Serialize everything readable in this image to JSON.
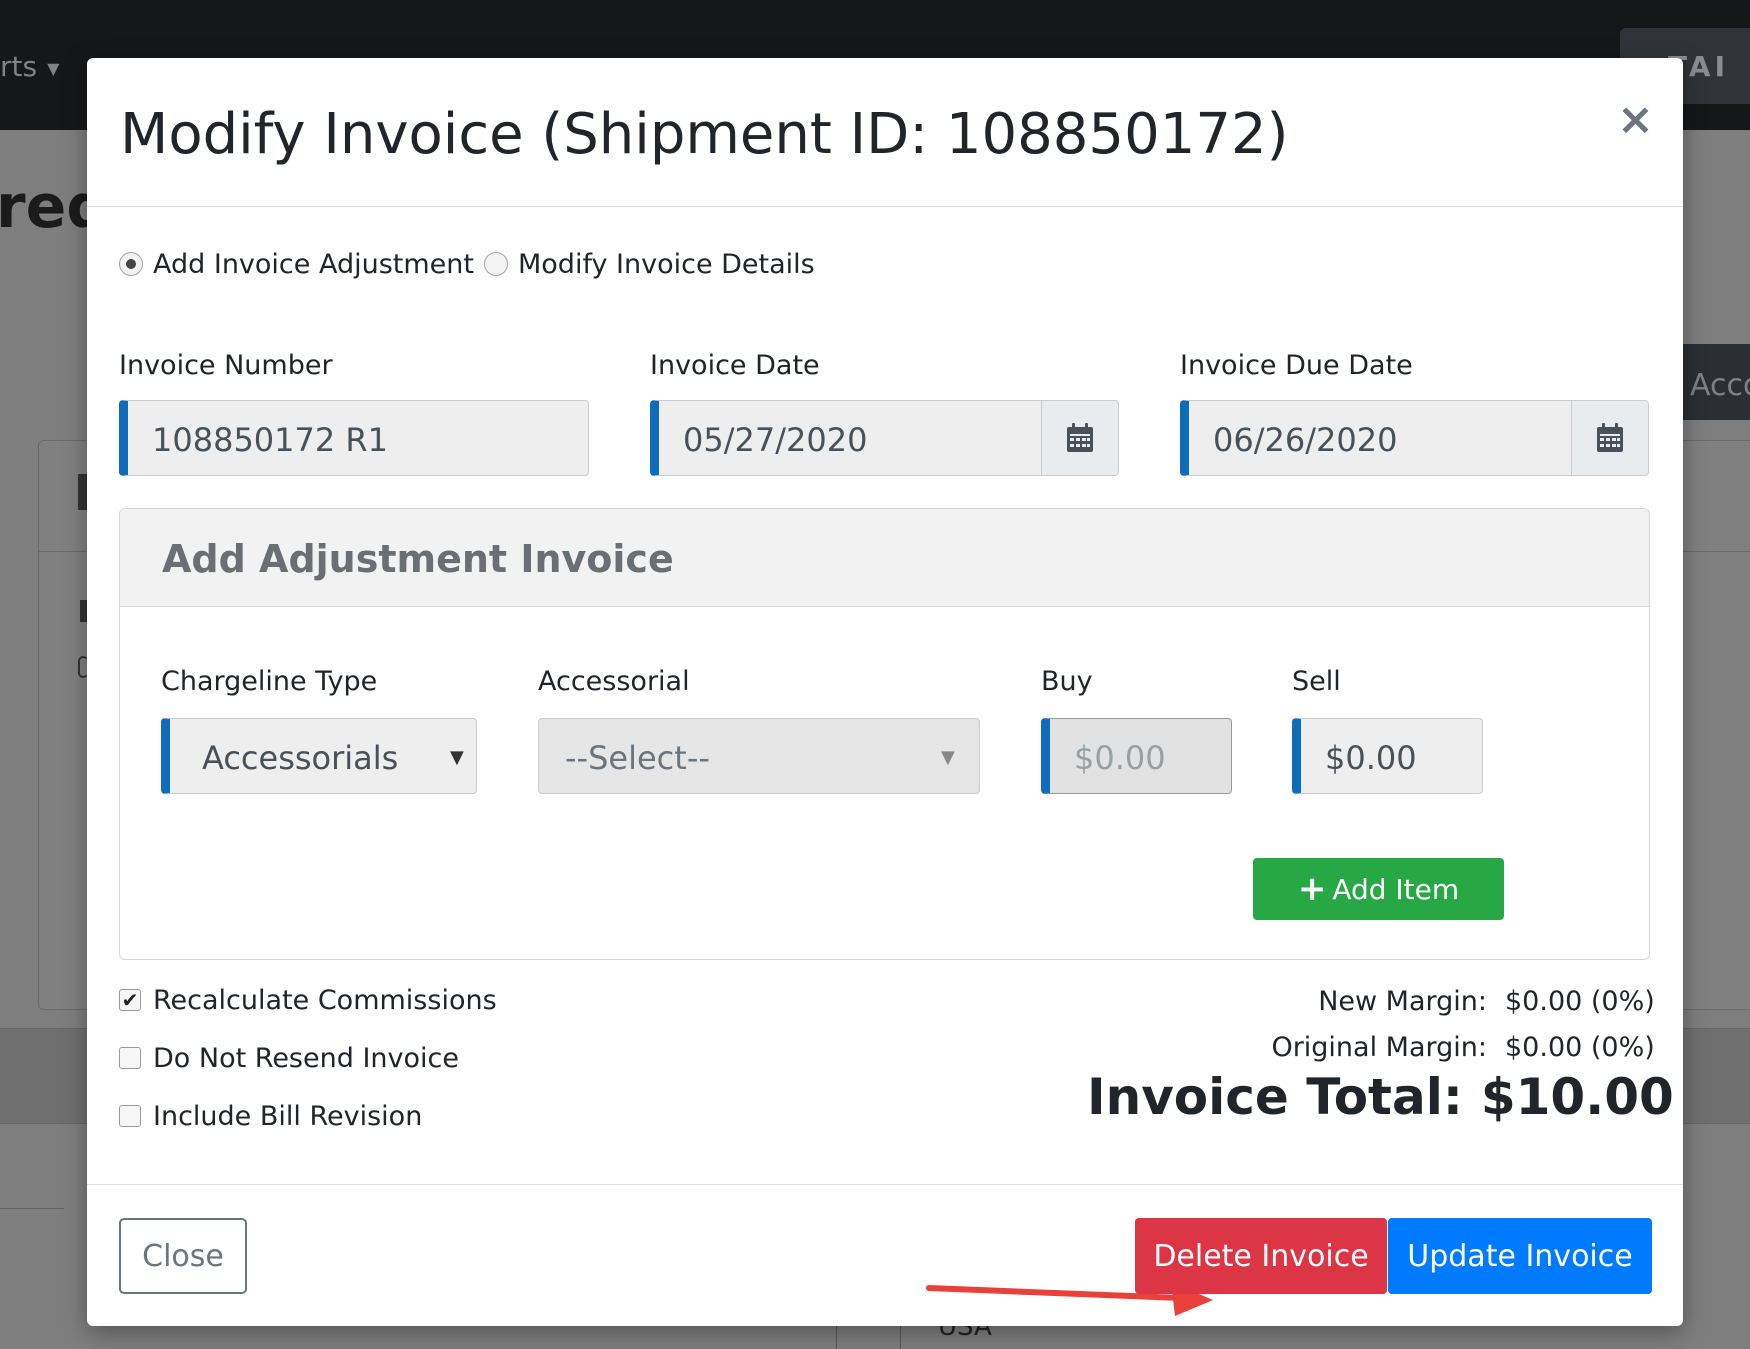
{
  "background": {
    "nav_text": "rts",
    "top_button_label": "TAI",
    "page_heading_fragment": "red",
    "right_button_fragment": "Acco",
    "country_text": "USA"
  },
  "modal": {
    "title": "Modify Invoice (Shipment ID: 108850172)",
    "close_symbol": "×",
    "mode_options": [
      {
        "label": "Add Invoice Adjustment",
        "selected": true
      },
      {
        "label": "Modify Invoice Details",
        "selected": false
      }
    ],
    "invoice_number": {
      "label": "Invoice Number",
      "value": "108850172 R1"
    },
    "invoice_date": {
      "label": "Invoice Date",
      "value": "05/27/2020"
    },
    "invoice_due_date": {
      "label": "Invoice Due Date",
      "value": "06/26/2020"
    },
    "adjustment": {
      "title": "Add Adjustment Invoice",
      "chargeline_type": {
        "label": "Chargeline Type",
        "value": "Accessorials"
      },
      "accessorial": {
        "label": "Accessorial",
        "value": "--Select--"
      },
      "buy": {
        "label": "Buy",
        "value": "$0.00"
      },
      "sell": {
        "label": "Sell",
        "value": "$0.00"
      },
      "add_item_label": "Add Item"
    },
    "options": [
      {
        "label": "Recalculate Commissions",
        "checked": true
      },
      {
        "label": "Do Not Resend Invoice",
        "checked": false
      },
      {
        "label": "Include Bill Revision",
        "checked": false
      }
    ],
    "summary": {
      "new_margin_label": "New Margin:",
      "new_margin_value": "$0.00 (0%)",
      "original_margin_label": "Original Margin:",
      "original_margin_value": "$0.00 (0%)",
      "invoice_total_label": "Invoice Total:",
      "invoice_total_value": "$10.00"
    },
    "footer": {
      "close_label": "Close",
      "delete_label": "Delete Invoice",
      "update_label": "Update Invoice"
    }
  },
  "colors": {
    "accent_blue": "#0f6cbd",
    "success_green": "#28a745",
    "danger_red": "#dc3545",
    "primary_blue": "#007bff",
    "annotation_arrow": "#e8403a"
  }
}
